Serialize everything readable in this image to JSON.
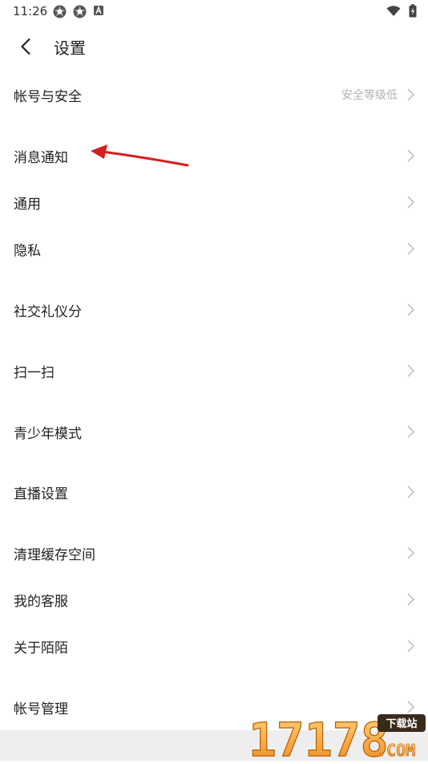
{
  "status_bar": {
    "time": "11:26"
  },
  "header": {
    "title": "设置"
  },
  "settings": {
    "items": [
      {
        "label": "帐号与安全",
        "value": "安全等级低"
      },
      {
        "label": "消息通知",
        "value": ""
      },
      {
        "label": "通用",
        "value": ""
      },
      {
        "label": "隐私",
        "value": ""
      },
      {
        "label": "社交礼仪分",
        "value": ""
      },
      {
        "label": "扫一扫",
        "value": ""
      },
      {
        "label": "青少年模式",
        "value": ""
      },
      {
        "label": "直播设置",
        "value": ""
      },
      {
        "label": "清理缓存空间",
        "value": ""
      },
      {
        "label": "我的客服",
        "value": ""
      },
      {
        "label": "关于陌陌",
        "value": ""
      },
      {
        "label": "帐号管理",
        "value": ""
      }
    ]
  },
  "watermark": {
    "text": "17178",
    "badge": "下载站",
    "suffix": ".COM"
  },
  "colors": {
    "accent_arrow": "#d42020",
    "chevron": "#c2c2c2",
    "secondary_text": "#b3b3b3"
  }
}
